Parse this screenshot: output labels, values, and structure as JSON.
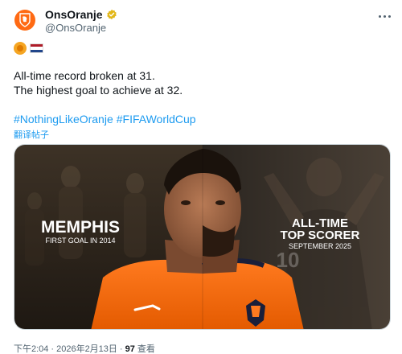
{
  "account": {
    "display_name": "OnsOranje",
    "handle": "@OnsOranje"
  },
  "emojis": [
    "lion-emoji",
    "netherlands-flag-emoji"
  ],
  "tweet": {
    "line1": "All-time record broken at 31.",
    "line2": "The highest goal to achieve at 32.",
    "hashtags": [
      "#NothingLikeOranje",
      "#FIFAWorldCup"
    ],
    "translate_label": "翻译帖子"
  },
  "media": {
    "left_title": "MEMPHIS",
    "left_subtitle": "FIRST GOAL IN 2014",
    "right_title_line1": "ALL-TIME",
    "right_title_line2": "TOP SCORER",
    "right_subtitle": "SEPTEMBER 2025",
    "jersey_number": "10"
  },
  "meta": {
    "time": "下午2:04",
    "separator1": "·",
    "date": "2026年2月13日",
    "separator2": "·",
    "views_count": "97",
    "views_label": "查看"
  },
  "colors": {
    "brand_orange": "#ff6a13",
    "link_blue": "#1d9bf0",
    "verified_gold": "#e2b719"
  }
}
